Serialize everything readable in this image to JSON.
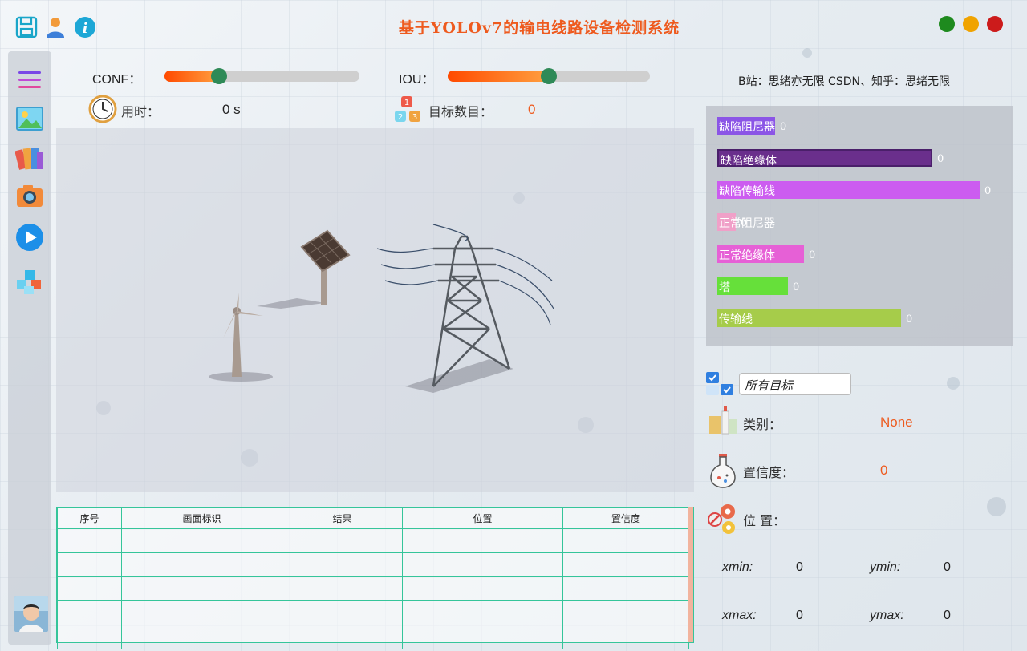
{
  "window": {
    "title": "基于YOLOv7的输电线路设备检测系统",
    "buttons": {
      "minimize_color": "#1e8a1e",
      "maximize_color": "#f0a300",
      "close_color": "#cc1b1b"
    }
  },
  "top_icons": [
    "save-icon",
    "user-icon",
    "info-icon"
  ],
  "sidebar": {
    "items": [
      "menu-icon",
      "image-icon",
      "folder-icon",
      "camera-icon",
      "play-icon",
      "cubes-icon"
    ]
  },
  "controls": {
    "conf": {
      "label": "CONF：",
      "value": 0.28
    },
    "iou": {
      "label": "IOU：",
      "value": 0.5
    }
  },
  "stats": {
    "time_label": "用时：",
    "time_value": "0 s",
    "count_label": "目标数目：",
    "count_value": "0"
  },
  "credit": "B站：思绪亦无限  CSDN、知乎：思绪无限",
  "class_chart": {
    "bars": [
      {
        "label": "缺陷阻尼器",
        "value": "0",
        "color": "#8b55e6",
        "fill": 0.22
      },
      {
        "label": "缺陷绝缘体",
        "value": "0",
        "color": "#6a2f8c",
        "fill": 0.82
      },
      {
        "label": "缺陷传输线",
        "value": "0",
        "color": "#cc5cf0",
        "fill": 1.0
      },
      {
        "label": "正常阻尼器",
        "value": "0",
        "color": "#f0a0c8",
        "fill": 0.07
      },
      {
        "label": "正常绝缘体",
        "value": "0",
        "color": "#e660d6",
        "fill": 0.33
      },
      {
        "label": "塔",
        "value": "0",
        "color": "#66e03a",
        "fill": 0.27
      },
      {
        "label": "传输线",
        "value": "0",
        "color": "#a6cc4a",
        "fill": 0.7
      }
    ]
  },
  "target_select": {
    "value": "所有目标"
  },
  "detail": {
    "class_label": "类别：",
    "class_value": "None",
    "conf_label": "置信度：",
    "conf_value": "0",
    "pos_label": "位  置：",
    "xmin_label": "xmin:",
    "xmin": "0",
    "ymin_label": "ymin:",
    "ymin": "0",
    "xmax_label": "xmax:",
    "xmax": "0",
    "ymax_label": "ymax:",
    "ymax": "0"
  },
  "table": {
    "headers": [
      "序号",
      "画面标识",
      "结果",
      "位置",
      "置信度"
    ],
    "rows": [
      [
        "",
        "",
        "",
        "",
        ""
      ],
      [
        "",
        "",
        "",
        "",
        ""
      ],
      [
        "",
        "",
        "",
        "",
        ""
      ],
      [
        "",
        "",
        "",
        "",
        ""
      ],
      [
        "",
        "",
        "",
        "",
        ""
      ]
    ]
  }
}
